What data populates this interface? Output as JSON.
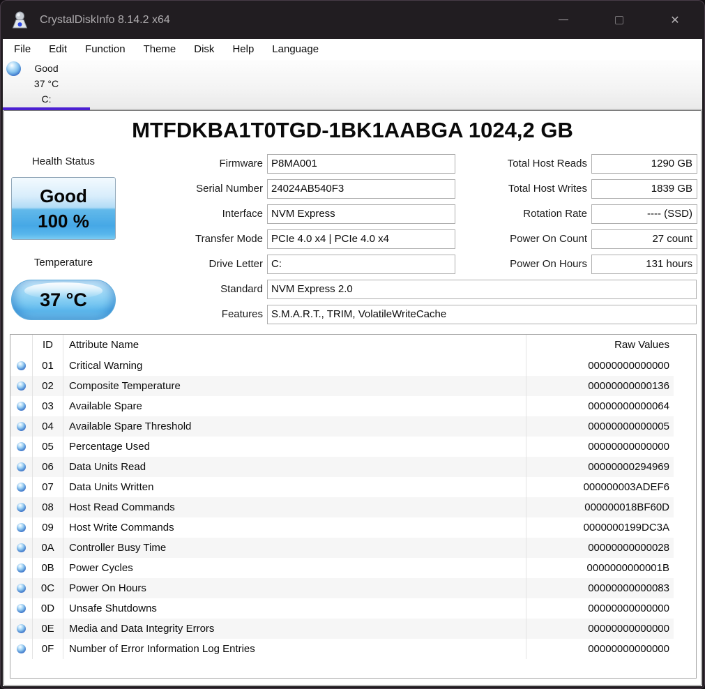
{
  "window": {
    "title": "CrystalDiskInfo 8.14.2 x64"
  },
  "icons": {
    "close": "✕"
  },
  "colors": {
    "accent_underline": "#4c20d2",
    "titlebar_bg": "#211d21",
    "health_button_blue": "#46a8e6",
    "status_orb_blue": "#58a0e2"
  },
  "menu": {
    "items": [
      "File",
      "Edit",
      "Function",
      "Theme",
      "Disk",
      "Help",
      "Language"
    ]
  },
  "drive_tab": {
    "status": "Good",
    "temperature": "37 °C",
    "letter": "C:"
  },
  "drive": {
    "model_title": "MTFDKBA1T0TGD-1BK1AABGA 1024,2 GB",
    "health": {
      "label": "Health Status",
      "status": "Good",
      "percent": "100 %"
    },
    "temperature": {
      "label": "Temperature",
      "value": "37 °C"
    },
    "fields_mid": [
      {
        "label": "Firmware",
        "value": "P8MA001"
      },
      {
        "label": "Serial Number",
        "value": "24024AB540F3"
      },
      {
        "label": "Interface",
        "value": "NVM Express"
      },
      {
        "label": "Transfer Mode",
        "value": "PCIe 4.0 x4 | PCIe 4.0 x4"
      },
      {
        "label": "Drive Letter",
        "value": "C:"
      },
      {
        "label": "Standard",
        "value": "NVM Express 2.0"
      },
      {
        "label": "Features",
        "value": "S.M.A.R.T., TRIM, VolatileWriteCache"
      }
    ],
    "fields_right": [
      {
        "label": "Total Host Reads",
        "value": "1290 GB"
      },
      {
        "label": "Total Host Writes",
        "value": "1839 GB"
      },
      {
        "label": "Rotation Rate",
        "value": "---- (SSD)"
      },
      {
        "label": "Power On Count",
        "value": "27 count"
      },
      {
        "label": "Power On Hours",
        "value": "131 hours"
      }
    ]
  },
  "smart_table": {
    "headers": {
      "id": "ID",
      "name": "Attribute Name",
      "raw": "Raw Values"
    },
    "rows": [
      {
        "id": "01",
        "name": "Critical Warning",
        "raw": "00000000000000"
      },
      {
        "id": "02",
        "name": "Composite Temperature",
        "raw": "00000000000136"
      },
      {
        "id": "03",
        "name": "Available Spare",
        "raw": "00000000000064"
      },
      {
        "id": "04",
        "name": "Available Spare Threshold",
        "raw": "00000000000005"
      },
      {
        "id": "05",
        "name": "Percentage Used",
        "raw": "00000000000000"
      },
      {
        "id": "06",
        "name": "Data Units Read",
        "raw": "00000000294969"
      },
      {
        "id": "07",
        "name": "Data Units Written",
        "raw": "000000003ADEF6"
      },
      {
        "id": "08",
        "name": "Host Read Commands",
        "raw": "000000018BF60D"
      },
      {
        "id": "09",
        "name": "Host Write Commands",
        "raw": "0000000199DC3A"
      },
      {
        "id": "0A",
        "name": "Controller Busy Time",
        "raw": "00000000000028"
      },
      {
        "id": "0B",
        "name": "Power Cycles",
        "raw": "0000000000001B"
      },
      {
        "id": "0C",
        "name": "Power On Hours",
        "raw": "00000000000083"
      },
      {
        "id": "0D",
        "name": "Unsafe Shutdowns",
        "raw": "00000000000000"
      },
      {
        "id": "0E",
        "name": "Media and Data Integrity Errors",
        "raw": "00000000000000"
      },
      {
        "id": "0F",
        "name": "Number of Error Information Log Entries",
        "raw": "00000000000000"
      }
    ]
  }
}
